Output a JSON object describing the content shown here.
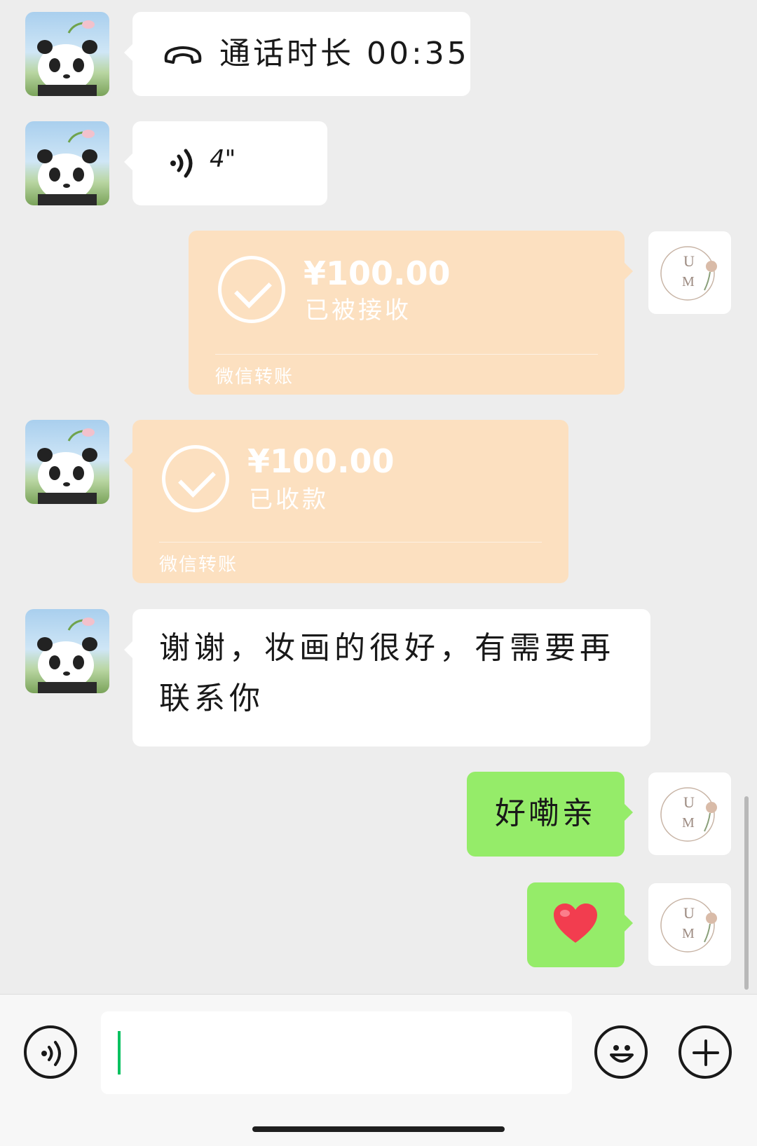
{
  "messages": {
    "call": {
      "icon": "phone-hangup-icon",
      "text": "通话时长 00:35"
    },
    "voice": {
      "icon": "voice-wave-icon",
      "duration": "4\""
    },
    "transfer_out": {
      "amount": "¥100.00",
      "status": "已被接收",
      "footer": "微信转账"
    },
    "transfer_in": {
      "amount": "¥100.00",
      "status": "已收款",
      "footer": "微信转账"
    },
    "thanks_text": "谢谢，妆画的很好，有需要再联系你",
    "reply_text": "好嘞亲",
    "heart": "❤️"
  },
  "self_avatar": {
    "letter1": "U",
    "letter2": "M"
  },
  "colors": {
    "background": "#ededed",
    "bubble_white": "#ffffff",
    "bubble_green": "#95ec69",
    "transfer_bubble": "#fce0c0",
    "cursor": "#07c160"
  },
  "input_bar": {
    "voice_icon": "voice-icon",
    "emoji_icon": "emoji-icon",
    "plus_icon": "plus-icon",
    "text_value": ""
  }
}
